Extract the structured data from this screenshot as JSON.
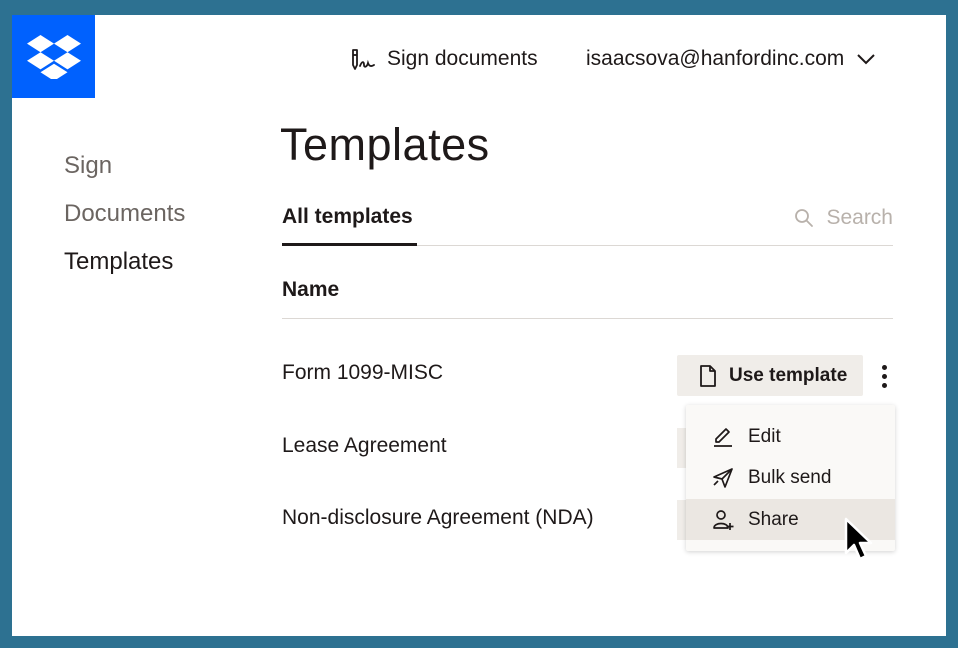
{
  "header": {
    "sign_documents": "Sign documents",
    "account_email": "isaacsova@hanfordinc.com"
  },
  "sidebar": {
    "items": [
      {
        "label": "Sign",
        "active": false
      },
      {
        "label": "Documents",
        "active": false
      },
      {
        "label": "Templates",
        "active": true
      }
    ]
  },
  "main": {
    "title": "Templates",
    "tabs": [
      {
        "label": "All templates",
        "active": true
      }
    ],
    "search_placeholder": "Search",
    "column_header": "Name",
    "rows": [
      {
        "name": "Form 1099-MISC"
      },
      {
        "name": "Lease Agreement"
      },
      {
        "name": "Non-disclosure Agreement (NDA)"
      }
    ],
    "use_template_label": "Use template"
  },
  "context_menu": {
    "items": [
      {
        "label": "Edit",
        "icon": "pencil-icon"
      },
      {
        "label": "Bulk send",
        "icon": "paper-plane-icon"
      },
      {
        "label": "Share",
        "icon": "add-user-icon",
        "hovered": true
      }
    ]
  },
  "colors": {
    "brand_blue": "#0061fe",
    "border_teal": "#2d7191",
    "button_bg": "#f0ede9",
    "text": "#1e1919",
    "muted_text": "#6b6561"
  }
}
